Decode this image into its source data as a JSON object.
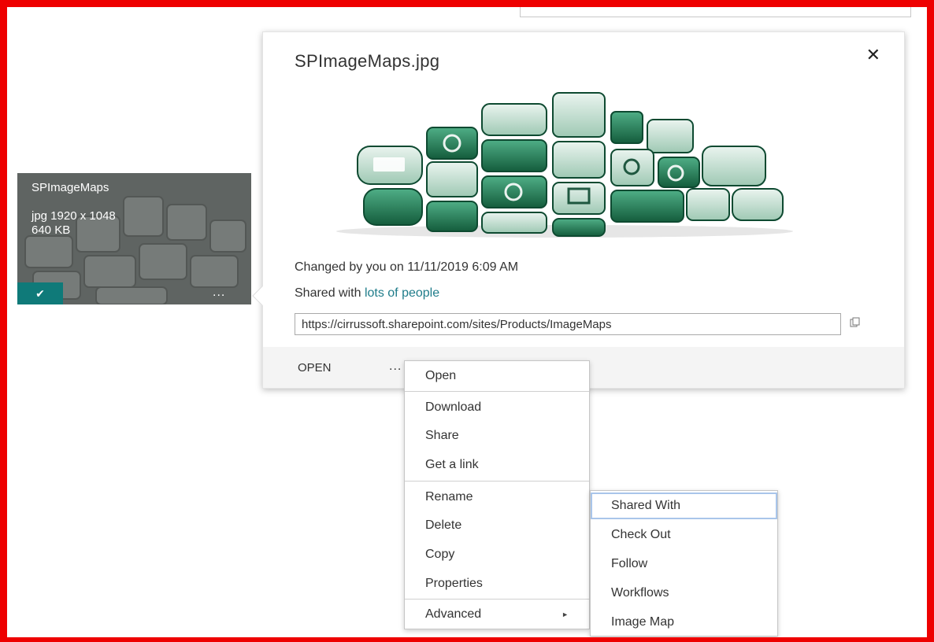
{
  "tile": {
    "name": "SPImageMaps",
    "meta_line1": "jpg 1920 x 1048",
    "meta_line2": "640 KB",
    "check_glyph": "✔",
    "dots": "..."
  },
  "callout": {
    "title": "SPImageMaps.jpg",
    "close_glyph": "✕",
    "changed_text": "Changed by you on 11/11/2019 6:09 AM",
    "shared_prefix": "Shared with ",
    "shared_link": "lots of people",
    "url_value": "https://cirrussoft.sharepoint.com/sites/Products/ImageMaps",
    "open_label": "OPEN",
    "dots": "..."
  },
  "context_menu": {
    "items": [
      "Open",
      "Download",
      "Share",
      "Get a link",
      "Rename",
      "Delete",
      "Copy",
      "Properties",
      "Advanced"
    ],
    "submenu_arrow": "►"
  },
  "advanced_submenu": {
    "items": [
      "Shared With",
      "Check Out",
      "Follow",
      "Workflows",
      "Image Map"
    ]
  },
  "colors": {
    "frame": "#ee0000",
    "accent": "#0f7a79",
    "link": "#1f7c8a",
    "cloud_green": "#1e7a52"
  }
}
